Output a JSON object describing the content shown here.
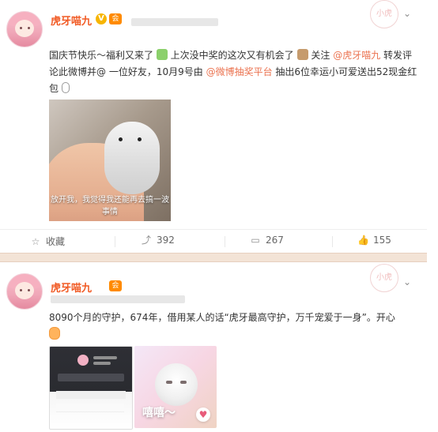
{
  "colors": {
    "accent": "#f15a24",
    "link": "#eb7350",
    "separator": "#f3e3d6"
  },
  "posts": [
    {
      "user": {
        "name": "虎牙喵九",
        "verified_badge": "V",
        "member_badge": "会"
      },
      "watermark_text": "小虎",
      "content": {
        "segments": [
          {
            "text": "国庆节快乐～福利又来了",
            "type": "text"
          },
          {
            "text": "上次没中奖的这次又有机会了",
            "type": "text"
          },
          {
            "text": "关注",
            "type": "text"
          },
          {
            "text": "@虎牙喵九",
            "type": "link"
          },
          {
            "text": " 转发评论此微博并@ 一位好友，10月9号由",
            "type": "text"
          },
          {
            "text": "@微博抽奖平台",
            "type": "link"
          },
          {
            "text": " 抽出6位幸运小可爱送出52现金红包",
            "type": "text"
          }
        ]
      },
      "image": {
        "caption": "放开我，我觉得我还能再去搞一波事情"
      },
      "actions": {
        "favorite_label": "收藏",
        "share_count": "392",
        "comment_count": "267",
        "like_count": "155",
        "icons": {
          "favorite": "star-icon",
          "share": "share-icon",
          "comment": "comment-icon",
          "like": "thumbs-up-icon"
        }
      }
    },
    {
      "user": {
        "name": "虎牙喵九",
        "member_badge": "会"
      },
      "watermark_text": "小虎",
      "content": {
        "text": "8090个月的守护，674年，借用某人的话“虎牙最高守护，万千宠爱于一身”。开心"
      },
      "images": [
        {
          "alt": "app-screenshot"
        },
        {
          "overlay_text": "嘻嘻～"
        }
      ]
    }
  ]
}
